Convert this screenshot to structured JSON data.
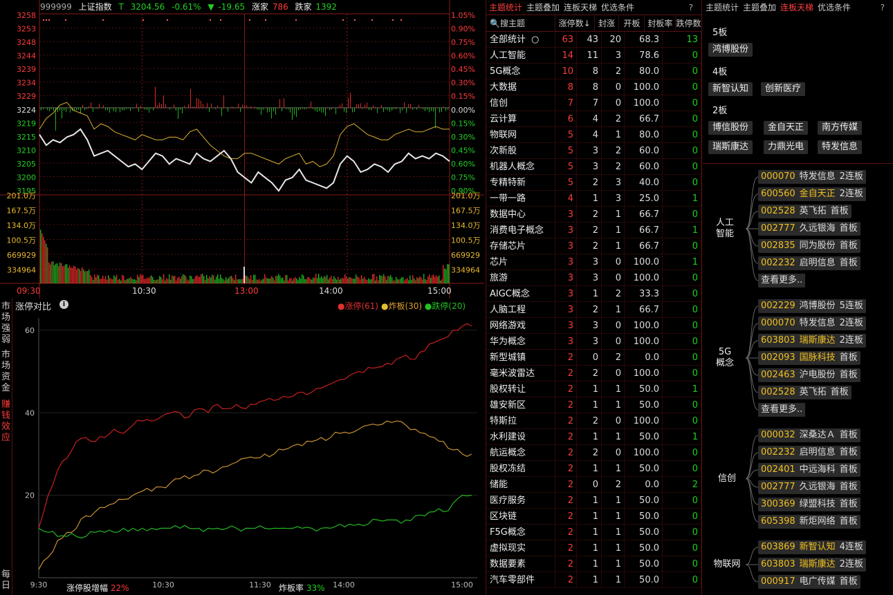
{
  "index_bar": {
    "code": "999999",
    "name": "上证指数",
    "t_label": "T",
    "price": "3204.56",
    "pct": "-0.61%",
    "arrow": "▼",
    "change": "-19.65",
    "up_label": "涨家",
    "up_count": "786",
    "down_label": "跌家",
    "down_count": "1392"
  },
  "intraday": {
    "price_ticks": [
      "3258",
      "3253",
      "3248",
      "3244",
      "3239",
      "3234",
      "3229",
      "3224",
      "3219",
      "3215",
      "3210",
      "3205",
      "3200",
      "3195"
    ],
    "pct_ticks": [
      "1.05%",
      "0.90%",
      "0.75%",
      "0.60%",
      "0.45%",
      "0.30%",
      "0.15%",
      "0.00%",
      "0.15%",
      "0.30%",
      "0.45%",
      "0.60%",
      "0.75%",
      "0.90%"
    ],
    "vol_ticks": [
      "201.0万",
      "167.5万",
      "134.0万",
      "100.5万",
      "669929",
      "334964"
    ],
    "time_ticks": [
      "09:30",
      "10:30",
      "13:00",
      "14:00",
      "15:00"
    ],
    "prev_close": 3224,
    "line_white": [
      3214,
      3210,
      3212,
      3211,
      3213,
      3214,
      3216,
      3212,
      3206,
      3207,
      3208,
      3206,
      3204,
      3202,
      3203,
      3201,
      3204,
      3207,
      3206,
      3203,
      3205,
      3204,
      3203,
      3207,
      3205,
      3204,
      3206,
      3208,
      3205,
      3200,
      3198,
      3196,
      3200,
      3198,
      3196,
      3193,
      3197,
      3198,
      3201,
      3197,
      3196,
      3195,
      3194,
      3196,
      3203,
      3206,
      3204,
      3200,
      3201,
      3203,
      3202,
      3200,
      3203,
      3204,
      3207,
      3205,
      3206,
      3205,
      3207,
      3206,
      3204
    ],
    "line_yellow": [
      3216,
      3220,
      3222,
      3225,
      3226,
      3223,
      3222,
      3221,
      3216,
      3218,
      3217,
      3215,
      3214,
      3213,
      3212,
      3214,
      3213,
      3212,
      3212,
      3213,
      3213,
      3212,
      3215,
      3216,
      3213,
      3210,
      3208,
      3206,
      3205,
      3205,
      3207,
      3207,
      3206,
      3205,
      3204,
      3203,
      3205,
      3206,
      3207,
      3203,
      3204,
      3202,
      3203,
      3206,
      3214,
      3217,
      3218,
      3216,
      3214,
      3213,
      3212,
      3212,
      3214,
      3215,
      3216,
      3215,
      3215,
      3216,
      3217,
      3216,
      3216
    ]
  },
  "limit_compare": {
    "title": "涨停对比",
    "legend": [
      {
        "label": "涨停(61)",
        "color": "#e03030"
      },
      {
        "label": "炸板(30)",
        "color": "#e0a030"
      },
      {
        "label": "跌停(20)",
        "color": "#22c022"
      }
    ],
    "side_tabs": [
      "市场强弱",
      "市场资金",
      "赚钱效应"
    ],
    "side_bottom": "每日",
    "y_ticks": [
      "60",
      "40",
      "20"
    ],
    "x_ticks": [
      "9:30",
      "10:30",
      "11:30",
      "14:00",
      "15:00"
    ],
    "footer_left_label": "涨停股增幅",
    "footer_left_value": "22%",
    "footer_right_label": "炸板率",
    "footer_right_value": "33%",
    "chart_data": {
      "type": "line",
      "ylim": [
        0,
        63
      ],
      "series": [
        {
          "name": "涨停(61)",
          "values": [
            12,
            20,
            26,
            29,
            33,
            34,
            33,
            34,
            36,
            35,
            37,
            38,
            38,
            39,
            40,
            40,
            39,
            41,
            40,
            42,
            41,
            42,
            41,
            42,
            43,
            43,
            44,
            44,
            45,
            45,
            46,
            47,
            48,
            49,
            50,
            51,
            51,
            52,
            53,
            54,
            53,
            55,
            57,
            58,
            60,
            61,
            61
          ]
        },
        {
          "name": "炸板(30)",
          "values": [
            2,
            5,
            9,
            11,
            12,
            15,
            16,
            17,
            18,
            19,
            20,
            21,
            21,
            22,
            23,
            24,
            24,
            25,
            26,
            26,
            27,
            28,
            29,
            29,
            30,
            30,
            31,
            32,
            32,
            33,
            34,
            34,
            35,
            35,
            36,
            37,
            37,
            38,
            38,
            37,
            36,
            35,
            34,
            33,
            31,
            30,
            30
          ]
        },
        {
          "name": "跌停(20)",
          "values": [
            12,
            11,
            10,
            10,
            10,
            10,
            11,
            11,
            11,
            12,
            12,
            12,
            12,
            12,
            12,
            12,
            12,
            12,
            12,
            12,
            12,
            12,
            12,
            12,
            12,
            12,
            12,
            12,
            12,
            12,
            12,
            12,
            13,
            13,
            13,
            13,
            14,
            14,
            14,
            14,
            15,
            15,
            16,
            16,
            18,
            20,
            20
          ]
        }
      ]
    }
  },
  "themes": {
    "tabs": [
      "主题统计",
      "主题叠加",
      "连板天梯",
      "优选条件"
    ],
    "help": "?",
    "headers": [
      "搜主题",
      "涨停数↓",
      "封涨",
      "开板",
      "封板率",
      "跌停数"
    ],
    "rows": [
      [
        "全部统计",
        "63",
        "43",
        "20",
        "68.3",
        "13"
      ],
      [
        "人工智能",
        "14",
        "11",
        "3",
        "78.6",
        "0"
      ],
      [
        "5G概念",
        "10",
        "8",
        "2",
        "80.0",
        "0"
      ],
      [
        "大数据",
        "8",
        "8",
        "0",
        "100.0",
        "0"
      ],
      [
        "信创",
        "7",
        "7",
        "0",
        "100.0",
        "0"
      ],
      [
        "云计算",
        "6",
        "4",
        "2",
        "66.7",
        "0"
      ],
      [
        "物联网",
        "5",
        "4",
        "1",
        "80.0",
        "0"
      ],
      [
        "次新股",
        "5",
        "3",
        "2",
        "60.0",
        "0"
      ],
      [
        "机器人概念",
        "5",
        "3",
        "2",
        "60.0",
        "0"
      ],
      [
        "专精特新",
        "5",
        "2",
        "3",
        "40.0",
        "0"
      ],
      [
        "一带一路",
        "4",
        "1",
        "3",
        "25.0",
        "1"
      ],
      [
        "数据中心",
        "3",
        "2",
        "1",
        "66.7",
        "0"
      ],
      [
        "消费电子概念",
        "3",
        "2",
        "1",
        "66.7",
        "1"
      ],
      [
        "存储芯片",
        "3",
        "2",
        "1",
        "66.7",
        "0"
      ],
      [
        "芯片",
        "3",
        "3",
        "0",
        "100.0",
        "1"
      ],
      [
        "旅游",
        "3",
        "3",
        "0",
        "100.0",
        "0"
      ],
      [
        "AIGC概念",
        "3",
        "1",
        "2",
        "33.3",
        "0"
      ],
      [
        "人脑工程",
        "3",
        "2",
        "1",
        "66.7",
        "0"
      ],
      [
        "网络游戏",
        "3",
        "3",
        "0",
        "100.0",
        "0"
      ],
      [
        "华为概念",
        "3",
        "3",
        "0",
        "100.0",
        "0"
      ],
      [
        "新型城镇",
        "2",
        "0",
        "2",
        "0.0",
        "0"
      ],
      [
        "毫米波雷达",
        "2",
        "2",
        "0",
        "100.0",
        "0"
      ],
      [
        "股权转让",
        "2",
        "1",
        "1",
        "50.0",
        "1"
      ],
      [
        "雄安新区",
        "2",
        "1",
        "1",
        "50.0",
        "0"
      ],
      [
        "特斯拉",
        "2",
        "2",
        "0",
        "100.0",
        "0"
      ],
      [
        "水利建设",
        "2",
        "1",
        "1",
        "50.0",
        "1"
      ],
      [
        "航运概念",
        "2",
        "2",
        "0",
        "100.0",
        "0"
      ],
      [
        "股权冻结",
        "2",
        "1",
        "1",
        "50.0",
        "0"
      ],
      [
        "储能",
        "2",
        "0",
        "2",
        "0.0",
        "2"
      ],
      [
        "医疗服务",
        "2",
        "1",
        "1",
        "50.0",
        "0"
      ],
      [
        "区块链",
        "2",
        "1",
        "1",
        "50.0",
        "0"
      ],
      [
        "F5G概念",
        "2",
        "1",
        "1",
        "50.0",
        "0"
      ],
      [
        "虚拟现实",
        "2",
        "1",
        "1",
        "50.0",
        "0"
      ],
      [
        "数据要素",
        "2",
        "1",
        "1",
        "50.0",
        "0"
      ],
      [
        "汽车零部件",
        "2",
        "1",
        "1",
        "50.0",
        "0"
      ]
    ]
  },
  "ladder": {
    "tabs": [
      "主题统计",
      "主题叠加",
      "连板天梯",
      "优选条件"
    ],
    "help": "?",
    "levels": [
      {
        "label": "5板",
        "stocks": [
          "鸿博股份"
        ]
      },
      {
        "label": "4板",
        "stocks": [
          "新智认知",
          "创新医疗"
        ]
      },
      {
        "label": "2板",
        "stocks": [
          "博信股份",
          "金自天正",
          "南方传媒",
          "瑞斯康达",
          "力鼎光电",
          "特发信息"
        ]
      }
    ],
    "more": "查看更多..",
    "groups": [
      {
        "name": "人工智能",
        "items": [
          [
            "000070",
            "特发信息",
            "2连板"
          ],
          [
            "600560",
            "金自天正",
            "2连板"
          ],
          [
            "002528",
            "英飞拓",
            "首板"
          ],
          [
            "002777",
            "久远银海",
            "首板"
          ],
          [
            "002835",
            "同为股份",
            "首板"
          ],
          [
            "002232",
            "启明信息",
            "首板"
          ]
        ]
      },
      {
        "name": "5G概念",
        "items": [
          [
            "002229",
            "鸿博股份",
            "5连板"
          ],
          [
            "000070",
            "特发信息",
            "2连板"
          ],
          [
            "603803",
            "瑞斯康达",
            "2连板"
          ],
          [
            "002093",
            "国脉科技",
            "首板"
          ],
          [
            "002463",
            "沪电股份",
            "首板"
          ],
          [
            "002528",
            "英飞拓",
            "首板"
          ]
        ]
      },
      {
        "name": "信创",
        "items": [
          [
            "000032",
            "深桑达Ａ",
            "首板"
          ],
          [
            "002232",
            "启明信息",
            "首板"
          ],
          [
            "002401",
            "中远海科",
            "首板"
          ],
          [
            "002777",
            "久远银海",
            "首板"
          ],
          [
            "300369",
            "绿盟科技",
            "首板"
          ],
          [
            "605398",
            "新炬网络",
            "首板"
          ]
        ]
      },
      {
        "name": "物联网",
        "items": [
          [
            "603869",
            "新智认知",
            "4连板"
          ],
          [
            "603803",
            "瑞斯康达",
            "2连板"
          ],
          [
            "000917",
            "电广传媒",
            "首板"
          ]
        ]
      }
    ]
  }
}
